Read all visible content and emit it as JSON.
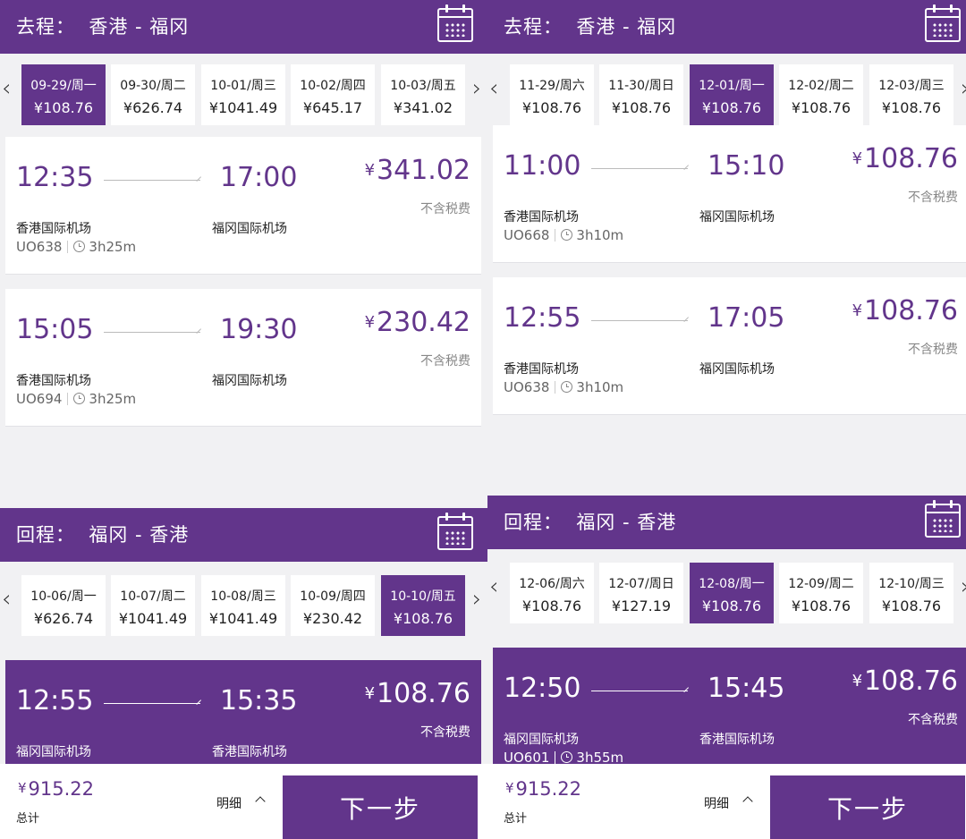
{
  "colors": {
    "accent": "#62358b",
    "background": "#f1f1f3"
  },
  "currency_symbol": "¥",
  "left": {
    "outbound": {
      "title": "去程：  香港 - 福冈",
      "dates": [
        {
          "date": "09-29/周一",
          "price": "¥108.76"
        },
        {
          "date": "09-30/周二",
          "price": "¥626.74"
        },
        {
          "date": "10-01/周三",
          "price": "¥1041.49"
        },
        {
          "date": "10-02/周四",
          "price": "¥645.17"
        },
        {
          "date": "10-03/周五",
          "price": "¥341.02"
        }
      ],
      "selected_index": 0,
      "flights": [
        {
          "dep": "12:35",
          "arr": "17:00",
          "price": "341.02",
          "tax": "不含税费",
          "from": "香港国际机场",
          "to": "福冈国际机场",
          "flight_no": "UO638",
          "duration": "3h25m"
        },
        {
          "dep": "15:05",
          "arr": "19:30",
          "price": "230.42",
          "tax": "不含税费",
          "from": "香港国际机场",
          "to": "福冈国际机场",
          "flight_no": "UO694",
          "duration": "3h25m"
        }
      ]
    },
    "return": {
      "title": "回程：  福冈 - 香港",
      "dates": [
        {
          "date": "10-06/周一",
          "price": "¥626.74"
        },
        {
          "date": "10-07/周二",
          "price": "¥1041.49"
        },
        {
          "date": "10-08/周三",
          "price": "¥1041.49"
        },
        {
          "date": "10-09/周四",
          "price": "¥230.42"
        },
        {
          "date": "10-10/周五",
          "price": "¥108.76"
        }
      ],
      "selected_index": 4,
      "flights": [
        {
          "dep": "12:55",
          "arr": "15:35",
          "price": "108.76",
          "tax": "不含税费",
          "from": "福冈国际机场",
          "to": "香港国际机场"
        }
      ]
    },
    "footer": {
      "total": "915.22",
      "total_label": "总计",
      "detail_label": "明细",
      "next_label": "下一步"
    }
  },
  "right": {
    "outbound": {
      "title": "去程：  香港 - 福冈",
      "dates": [
        {
          "date": "11-29/周六",
          "price": "¥108.76"
        },
        {
          "date": "11-30/周日",
          "price": "¥108.76"
        },
        {
          "date": "12-01/周一",
          "price": "¥108.76"
        },
        {
          "date": "12-02/周二",
          "price": "¥108.76"
        },
        {
          "date": "12-03/周三",
          "price": "¥108.76"
        }
      ],
      "selected_index": 2,
      "flights": [
        {
          "dep": "11:00",
          "arr": "15:10",
          "price": "108.76",
          "tax": "不含税费",
          "from": "香港国际机场",
          "to": "福冈国际机场",
          "flight_no": "UO668",
          "duration": "3h10m"
        },
        {
          "dep": "12:55",
          "arr": "17:05",
          "price": "108.76",
          "tax": "不含税费",
          "from": "香港国际机场",
          "to": "福冈国际机场",
          "flight_no": "UO638",
          "duration": "3h10m"
        }
      ]
    },
    "return": {
      "title": "回程：  福冈 - 香港",
      "dates": [
        {
          "date": "12-06/周六",
          "price": "¥108.76"
        },
        {
          "date": "12-07/周日",
          "price": "¥127.19"
        },
        {
          "date": "12-08/周一",
          "price": "¥108.76"
        },
        {
          "date": "12-09/周二",
          "price": "¥108.76"
        },
        {
          "date": "12-10/周三",
          "price": "¥108.76"
        }
      ],
      "selected_index": 2,
      "flights": [
        {
          "dep": "12:50",
          "arr": "15:45",
          "price": "108.76",
          "tax": "不含税费",
          "from": "福冈国际机场",
          "to": "香港国际机场",
          "flight_no": "UO601",
          "duration": "3h55m"
        }
      ]
    },
    "footer": {
      "total": "915.22",
      "total_label": "总计",
      "detail_label": "明细",
      "next_label": "下一步"
    }
  }
}
